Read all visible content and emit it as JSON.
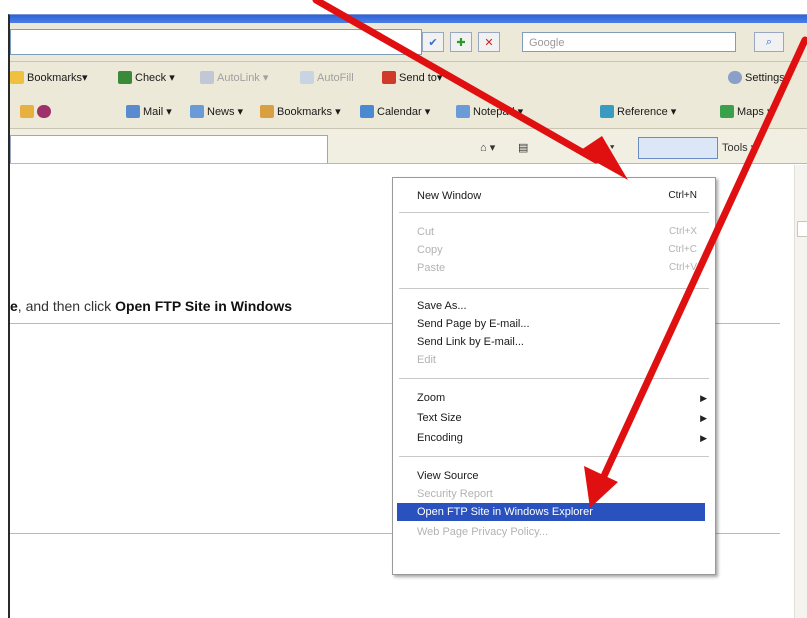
{
  "address_bar": {
    "search_placeholder": "Google",
    "go_glyph": "✔",
    "add_glyph": "✚",
    "stop_glyph": "✕",
    "search_glyph": "⌕"
  },
  "toolbar1": {
    "items": [
      "Bookmarks▾",
      "Check ▾",
      "AutoLink ▾",
      "AutoFill",
      "Send to▾",
      "Settings▾"
    ]
  },
  "toolbar2": {
    "items": [
      "Mail ▾",
      "News ▾",
      "Bookmarks ▾",
      "Calendar ▾",
      "Notepad ▾",
      "Reference ▾",
      "Maps ▾"
    ]
  },
  "command_bar": {
    "tools_label": "Tools ▾"
  },
  "instruction": {
    "lead": "e",
    "middle": ", and then click ",
    "bold": "Open FTP Site in Windows"
  },
  "page_menu": {
    "new_window": "New Window",
    "new_window_shortcut": "Ctrl+N",
    "cut": "Cut",
    "cut_shortcut": "Ctrl+X",
    "copy": "Copy",
    "copy_shortcut": "Ctrl+C",
    "paste": "Paste",
    "paste_shortcut": "Ctrl+V",
    "save_as": "Save As...",
    "send_page": "Send Page by E-mail...",
    "send_link": "Send Link by E-mail...",
    "edit": "Edit",
    "zoom": "Zoom",
    "text_size": "Text Size",
    "encoding": "Encoding",
    "view_source": "View Source",
    "security_report": "Security Report",
    "open_ftp": "Open FTP Site in Windows Explorer",
    "privacy_policy": "Web Page Privacy Policy..."
  },
  "colors": {
    "annotation_arrow": "#e01010",
    "menu_highlight": "#2a52be",
    "toolbar_bg": "#ece9d8"
  }
}
